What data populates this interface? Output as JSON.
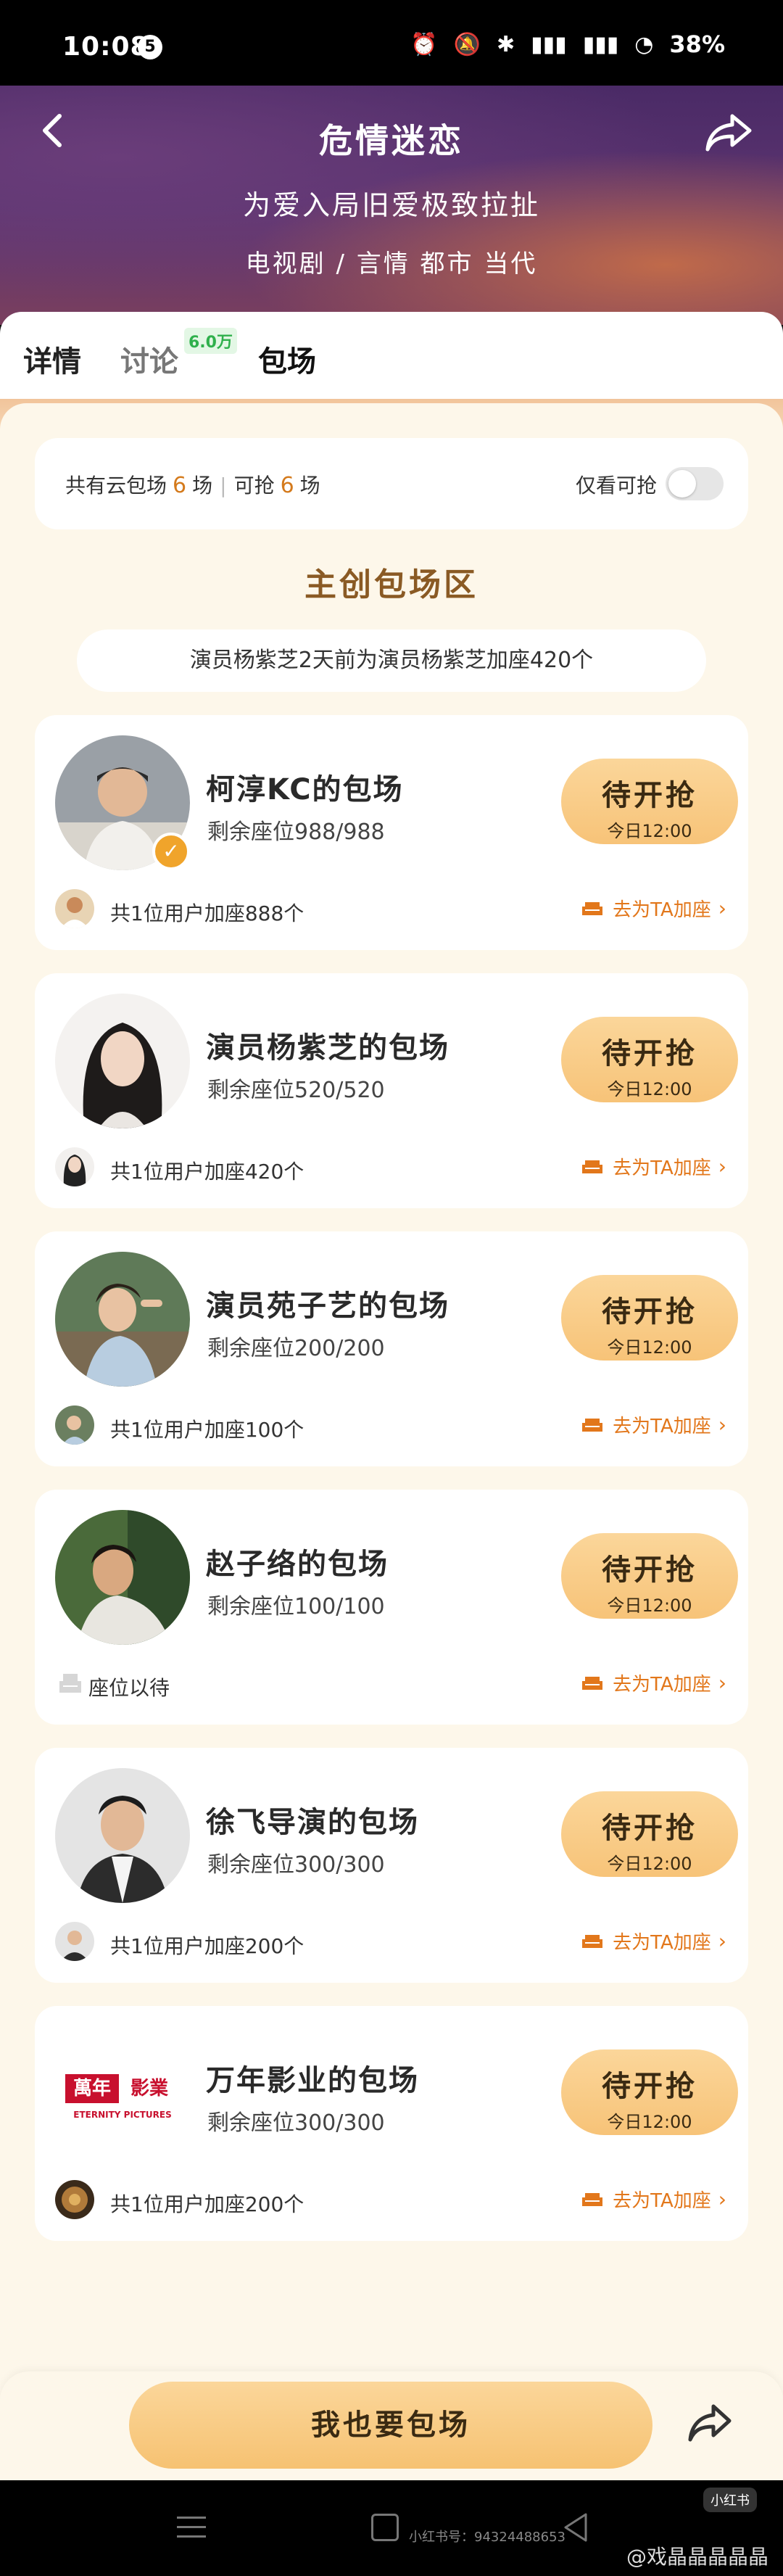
{
  "status_bar": {
    "time": "10:08",
    "notif_count": "5",
    "battery": "38%"
  },
  "header": {
    "title": "危情迷恋",
    "subtitle": "为爱入局旧爱极致拉扯",
    "meta": "电视剧 / 言情 都市 当代"
  },
  "tabs": {
    "detail": "详情",
    "discuss": "讨论",
    "discuss_badge": "6.0万",
    "booking": "包场"
  },
  "summary": {
    "prefix": "共有云包场",
    "total": "6",
    "unit1": "场",
    "sep": "|",
    "grab_prefix": "可抢",
    "grab": "6",
    "unit2": "场",
    "toggle_label": "仅看可抢"
  },
  "section_title": "主创包场区",
  "notice": "演员杨紫芝2天前为演员杨紫芝加座420个",
  "cards": [
    {
      "name": "柯淳KC的包场",
      "seats": "剩余座位988/988",
      "btn_label": "待开抢",
      "btn_time": "今日12:00",
      "footer": "共1位用户加座888个",
      "link": "去为TA加座"
    },
    {
      "name": "演员杨紫芝的包场",
      "seats": "剩余座位520/520",
      "btn_label": "待开抢",
      "btn_time": "今日12:00",
      "footer": "共1位用户加座420个",
      "link": "去为TA加座"
    },
    {
      "name": "演员苑子艺的包场",
      "seats": "剩余座位200/200",
      "btn_label": "待开抢",
      "btn_time": "今日12:00",
      "footer": "共1位用户加座100个",
      "link": "去为TA加座"
    },
    {
      "name": "赵子络的包场",
      "seats": "剩余座位100/100",
      "btn_label": "待开抢",
      "btn_time": "今日12:00",
      "footer": "座位以待",
      "link": "去为TA加座"
    },
    {
      "name": "徐飞导演的包场",
      "seats": "剩余座位300/300",
      "btn_label": "待开抢",
      "btn_time": "今日12:00",
      "footer": "共1位用户加座200个",
      "link": "去为TA加座"
    },
    {
      "name": "万年影业的包场",
      "seats": "剩余座位300/300",
      "btn_label": "待开抢",
      "btn_time": "今日12:00",
      "footer": "共1位用户加座200个",
      "link": "去为TA加座",
      "logo_text_cn": "萬年影業",
      "logo_text_en": "ETERNITY PICTURES"
    }
  ],
  "bottom": {
    "cta": "我也要包场"
  },
  "watermark": {
    "text": "@戏晶晶晶晶晶",
    "small": "小红书号：94324488653",
    "badge": "小红书"
  },
  "colors": {
    "accent": "#f7c378",
    "link": "#e2771b",
    "title_brown": "#8a5a24"
  }
}
